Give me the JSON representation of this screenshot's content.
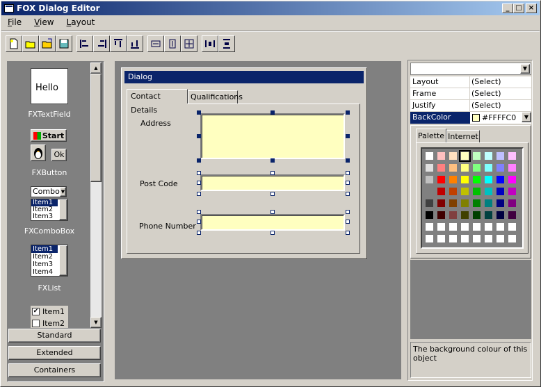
{
  "window": {
    "title": "FOX Dialog Editor"
  },
  "menu": [
    "File",
    "View",
    "Layout"
  ],
  "toolbar": {
    "buttons": [
      "new-file",
      "open-file",
      "open-folder",
      "save-file",
      "align-left",
      "align-right",
      "align-top",
      "align-bottom",
      "same-width",
      "same-height",
      "same-size",
      "space-horizontal",
      "space-vertical"
    ]
  },
  "palette": {
    "textfield_value": "Hello",
    "textfield_caption": "FXTextField",
    "start_label": "Start",
    "ok_label": "Ok",
    "button_caption": "FXButton",
    "combo_value": "Combo",
    "combo_items": [
      "Item1",
      "Item2",
      "Item3"
    ],
    "combo_caption": "FXComboBox",
    "list_items": [
      "Item1",
      "Item2",
      "Item3",
      "Item4"
    ],
    "list_caption": "FXList",
    "check_items": [
      "Item1",
      "Item2"
    ],
    "categories": [
      "Standard",
      "Extended",
      "Containers"
    ]
  },
  "dialog": {
    "title": "Dialog",
    "tabs": [
      "Contact  Details",
      "Qualifications"
    ],
    "fields": [
      {
        "label": "Address"
      },
      {
        "label": "Post Code"
      },
      {
        "label": "Phone Number"
      }
    ]
  },
  "properties": {
    "rows": [
      {
        "name": "Layout",
        "value": "(Select)"
      },
      {
        "name": "Frame",
        "value": "(Select)"
      },
      {
        "name": "Justify",
        "value": "(Select)"
      },
      {
        "name": "BackColor",
        "value": "#FFFFC0"
      }
    ],
    "color_tabs": [
      "Palette",
      "Internet"
    ],
    "swatches": [
      [
        "#ffffff",
        "#ffc0c0",
        "#ffe0c0",
        "#ffffc0",
        "#c0ffc0",
        "#c0ffff",
        "#c0c0ff",
        "#ffc0ff"
      ],
      [
        "#e0e0e0",
        "#ff8080",
        "#ffc080",
        "#ffff80",
        "#80ff80",
        "#80ffff",
        "#8080ff",
        "#ff80ff"
      ],
      [
        "#c0c0c0",
        "#ff0000",
        "#ff8000",
        "#ffff00",
        "#00ff00",
        "#00ffff",
        "#0000ff",
        "#ff00ff"
      ],
      [
        "#808080",
        "#c00000",
        "#c04000",
        "#c0c000",
        "#00c000",
        "#00c0c0",
        "#0000c0",
        "#c000c0"
      ],
      [
        "#404040",
        "#800000",
        "#804000",
        "#808000",
        "#008000",
        "#008080",
        "#000080",
        "#800080"
      ],
      [
        "#000000",
        "#400000",
        "#804040",
        "#404000",
        "#004000",
        "#004040",
        "#000040",
        "#400040"
      ],
      [
        "#ffffff",
        "#ffffff",
        "#ffffff",
        "#ffffff",
        "#ffffff",
        "#ffffff",
        "#ffffff",
        "#ffffff"
      ],
      [
        "#ffffff",
        "#ffffff",
        "#ffffff",
        "#ffffff",
        "#ffffff",
        "#ffffff",
        "#ffffff",
        "#ffffff"
      ]
    ],
    "description": "The background colour of this object"
  },
  "colors": {
    "title_start": "#0a246a",
    "title_end": "#a6caf0",
    "canvas": "#808080",
    "field_bg": "#ffffc0",
    "selection": "#0a246a"
  }
}
